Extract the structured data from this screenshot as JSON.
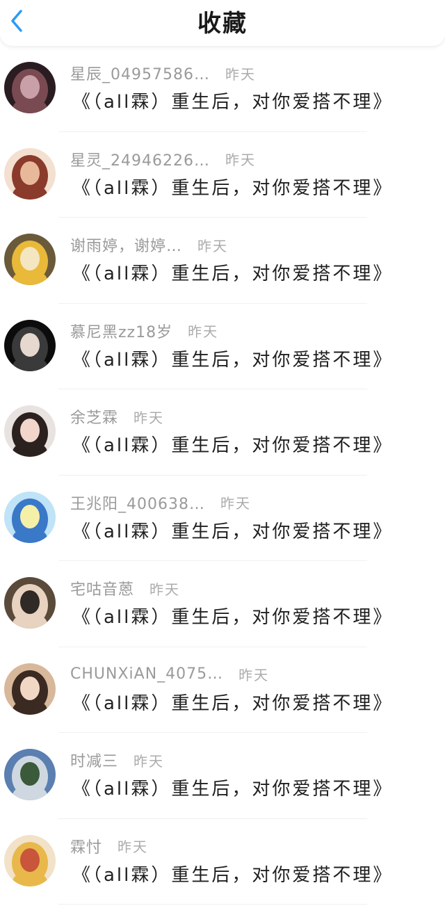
{
  "header": {
    "title": "收藏",
    "back_icon": "chevron-left-icon",
    "accent_color": "#2b9bf4"
  },
  "items": [
    {
      "name": "星辰_04957586…",
      "time": "昨天",
      "message": "《（all霖）重生后，对你爱搭不理》",
      "avatar_colors": [
        "#2a1d22",
        "#7a4a52",
        "#c9a0a8"
      ]
    },
    {
      "name": "星灵_24946226…",
      "time": "昨天",
      "message": "《（all霖）重生后，对你爱搭不理》",
      "avatar_colors": [
        "#f3e0d0",
        "#8a3b2c",
        "#e8b89a"
      ]
    },
    {
      "name": "谢雨婷，谢婷…",
      "time": "昨天",
      "message": "《（all霖）重生后，对你爱搭不理》",
      "avatar_colors": [
        "#6b5a3a",
        "#e9b93a",
        "#f5e6c2"
      ]
    },
    {
      "name": "慕尼黑zz18岁",
      "time": "昨天",
      "message": "《（all霖）重生后，对你爱搭不理》",
      "avatar_colors": [
        "#0c0c0c",
        "#3a3a3a",
        "#e6d8cf"
      ]
    },
    {
      "name": "余芝霖",
      "time": "昨天",
      "message": "《（all霖）重生后，对你爱搭不理》",
      "avatar_colors": [
        "#e8e2e0",
        "#2b2220",
        "#f2d6cc"
      ]
    },
    {
      "name": "王兆阳_400638…",
      "time": "昨天",
      "message": "《（all霖）重生后，对你爱搭不理》",
      "avatar_colors": [
        "#bfe3f7",
        "#3a78c8",
        "#f4f0a8"
      ]
    },
    {
      "name": "宅咕音蒽",
      "time": "昨天",
      "message": "《（all霖）重生后，对你爱搭不理》",
      "avatar_colors": [
        "#5a4a3a",
        "#e8d2c0",
        "#2f2a25"
      ]
    },
    {
      "name": "CHUNXiAN_4075…",
      "time": "昨天",
      "message": "《（all霖）重生后，对你爱搭不理》",
      "avatar_colors": [
        "#d8b89a",
        "#3b2a22",
        "#f0d8c4"
      ]
    },
    {
      "name": "时减三",
      "time": "昨天",
      "message": "《（all霖）重生后，对你爱搭不理》",
      "avatar_colors": [
        "#5a7fb0",
        "#cfd8e0",
        "#3a5a3a"
      ]
    },
    {
      "name": "霖忖",
      "time": "昨天",
      "message": "《（all霖）重生后，对你爱搭不理》",
      "avatar_colors": [
        "#f1e2c8",
        "#e8b84a",
        "#c9553a"
      ]
    }
  ]
}
